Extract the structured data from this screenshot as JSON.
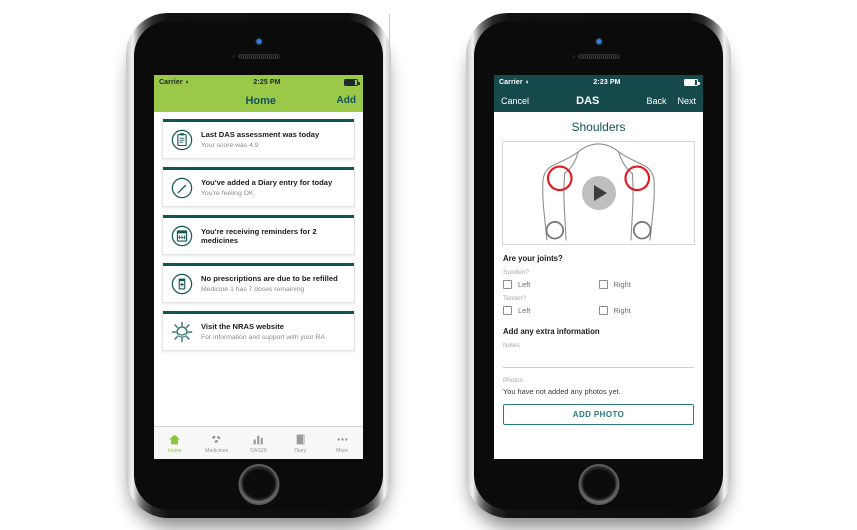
{
  "colors": {
    "brand_green": "#9ac94a",
    "brand_teal": "#16494b",
    "teal_dark": "#135456",
    "tab_active": "#8cc63f",
    "joint_selected": "#e11b22",
    "joint_unselected": "#7a7a7a"
  },
  "left_phone": {
    "status_bar": {
      "carrier": "Carrier",
      "wifi_icon": "wifi-icon",
      "time": "2:25 PM",
      "battery_icon": "battery-icon"
    },
    "nav": {
      "title": "Home",
      "action_label": "Add"
    },
    "cards": [
      {
        "icon": "clipboard-icon",
        "title": "Last DAS assessment was today",
        "subtitle": "Your score was 4.9"
      },
      {
        "icon": "pencil-circle-icon",
        "title": "You've added a Diary entry for today",
        "subtitle": "You're feeling OK"
      },
      {
        "icon": "calendar-icon",
        "title": "You're receiving reminders for 2 medicines",
        "subtitle": ""
      },
      {
        "icon": "pill-bottle-icon",
        "title": "No prescriptions are due to be refilled",
        "subtitle": "Medicine 1 has 7 doses remaining"
      },
      {
        "icon": "nras-sunburst-icon",
        "title": "Visit the NRAS website",
        "subtitle": "For information and support with your RA"
      }
    ],
    "tabs": [
      {
        "label": "Home",
        "icon": "home-icon",
        "active": true
      },
      {
        "label": "Medicines",
        "icon": "pills-icon",
        "active": false
      },
      {
        "label": "DAS28",
        "icon": "bar-chart-icon",
        "active": false
      },
      {
        "label": "Diary",
        "icon": "book-icon",
        "active": false
      },
      {
        "label": "More",
        "icon": "ellipsis-icon",
        "active": false
      }
    ]
  },
  "right_phone": {
    "status_bar": {
      "carrier": "Carrier",
      "wifi_icon": "wifi-icon",
      "time": "2:23 PM",
      "battery_icon": "battery-icon"
    },
    "nav": {
      "cancel": "Cancel",
      "title": "DAS",
      "back": "Back",
      "next": "Next"
    },
    "screen_title": "Shoulders",
    "body_diagram": {
      "play_icon": "play-icon",
      "joints": [
        {
          "name": "left-shoulder",
          "state": "selected"
        },
        {
          "name": "right-shoulder",
          "state": "selected"
        },
        {
          "name": "left-elbow",
          "state": "unselected"
        },
        {
          "name": "right-elbow",
          "state": "unselected"
        }
      ]
    },
    "form": {
      "question": "Are your joints?",
      "groups": [
        {
          "label": "Swollen?",
          "options": [
            {
              "label": "Left",
              "checked": false
            },
            {
              "label": "Right",
              "checked": false
            }
          ]
        },
        {
          "label": "Tender?",
          "options": [
            {
              "label": "Left",
              "checked": false
            },
            {
              "label": "Right",
              "checked": false
            }
          ]
        }
      ],
      "extra_info_title": "Add any extra information",
      "notes_label": "Notes",
      "notes_value": "",
      "photos_label": "Photos",
      "photos_empty_text": "You have not added any photos yet.",
      "add_photo_label": "ADD PHOTO"
    }
  }
}
